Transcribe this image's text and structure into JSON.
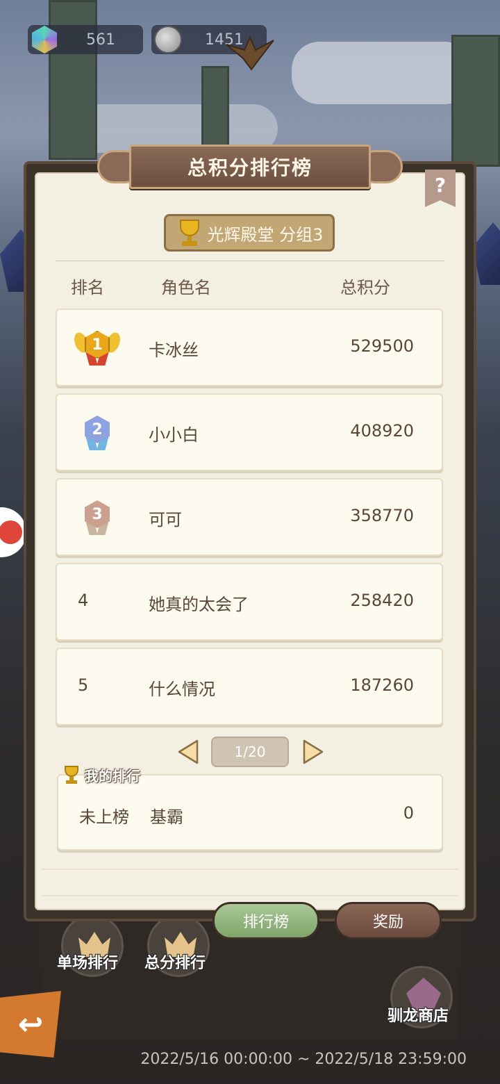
{
  "currency": {
    "gems": "561",
    "coins": "1451"
  },
  "panel": {
    "title": "总积分排行榜",
    "help_label": "?",
    "group_label": "光辉殿堂 分组3"
  },
  "table": {
    "headers": {
      "rank": "排名",
      "name": "角色名",
      "score": "总积分"
    },
    "rows": [
      {
        "rank": "1",
        "name": "卡冰丝",
        "score": "529500"
      },
      {
        "rank": "2",
        "name": "小小白",
        "score": "408920"
      },
      {
        "rank": "3",
        "name": "可可",
        "score": "358770"
      },
      {
        "rank": "4",
        "name": "她真的太会了",
        "score": "258420"
      },
      {
        "rank": "5",
        "name": "什么情况",
        "score": "187260"
      }
    ]
  },
  "pager": {
    "page": "1/20"
  },
  "my_rank": {
    "label": "我的排行",
    "status": "未上榜",
    "name": "基霸",
    "score": "0"
  },
  "tabs": {
    "rank_label": "排行榜",
    "reward_label": "奖励"
  },
  "bottom": {
    "single_rank_label": "单场排行",
    "total_rank_label": "总分排行",
    "dragon_shop_label": "驯龙商店",
    "date_range": "2022/5/16 00:00:00 ~ 2022/5/18 23:59:00"
  },
  "colors": {
    "panel_bg": "#f4efe3",
    "text_brown": "#5a4636",
    "gold": "#e7b520",
    "silver_blue": "#7f94d6",
    "bronze": "#c99a86",
    "tab_active": "#8fb47c",
    "tab_inactive": "#7a5848"
  }
}
